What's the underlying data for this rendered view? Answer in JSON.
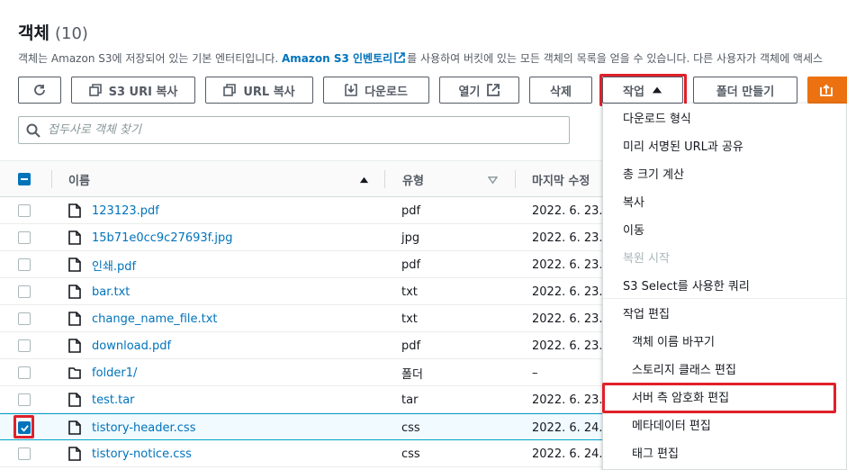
{
  "header": {
    "title": "객체",
    "count": "(10)",
    "description_before": "객체는 Amazon S3에 저장되어 있는 기본 엔터티입니다. ",
    "description_link": "Amazon S3 인벤토리",
    "description_after": "를 사용하여 버킷에 있는 모든 객체의 목록을 얻을 수 있습니다. 다른 사용자가 객체에 액세스"
  },
  "toolbar": {
    "refresh_icon": "refresh-icon",
    "copy_s3_uri": "S3 URI 복사",
    "copy_url": "URL 복사",
    "download": "다운로드",
    "open": "열기",
    "delete": "삭제",
    "actions": "작업",
    "create_folder": "폴더 만들기",
    "upload_icon": "upload-icon"
  },
  "search": {
    "placeholder": "접두사로 객체 찾기"
  },
  "table": {
    "columns": {
      "name": "이름",
      "type": "유형",
      "modified": "마지막 수정"
    },
    "rows": [
      {
        "name": "123123.pdf",
        "type": "pdf",
        "modified": "2022. 6. 23.",
        "icon": "file-icon",
        "checked": false
      },
      {
        "name": "15b71e0cc9c27693f.jpg",
        "type": "jpg",
        "modified": "2022. 6. 23.",
        "icon": "file-icon",
        "checked": false
      },
      {
        "name": "인쇄.pdf",
        "type": "pdf",
        "modified": "2022. 6. 23.",
        "icon": "file-icon",
        "checked": false
      },
      {
        "name": "bar.txt",
        "type": "txt",
        "modified": "2022. 6. 23.",
        "icon": "file-icon",
        "checked": false
      },
      {
        "name": "change_name_file.txt",
        "type": "txt",
        "modified": "2022. 6. 23.",
        "icon": "file-icon",
        "checked": false
      },
      {
        "name": "download.pdf",
        "type": "pdf",
        "modified": "2022. 6. 23.",
        "icon": "file-icon",
        "checked": false
      },
      {
        "name": "folder1/",
        "type": "폴더",
        "modified": "–",
        "icon": "folder-icon",
        "checked": false
      },
      {
        "name": "test.tar",
        "type": "tar",
        "modified": "2022. 6. 23.",
        "icon": "file-icon",
        "checked": false
      },
      {
        "name": "tistory-header.css",
        "type": "css",
        "modified": "2022. 6. 24.",
        "icon": "file-icon",
        "checked": true
      },
      {
        "name": "tistory-notice.css",
        "type": "css",
        "modified": "2022. 6. 24.",
        "icon": "file-icon",
        "checked": false
      }
    ]
  },
  "actions_menu": {
    "items": [
      {
        "label": "다운로드 형식",
        "enabled": true
      },
      {
        "label": "미리 서명된 URL과 공유",
        "enabled": true
      },
      {
        "label": "총 크기 계산",
        "enabled": true
      },
      {
        "label": "복사",
        "enabled": true
      },
      {
        "label": "이동",
        "enabled": true
      },
      {
        "label": "복원 시작",
        "enabled": false
      },
      {
        "label": "S3 Select를 사용한 쿼리",
        "enabled": true
      }
    ],
    "edit_group_label": "작업 편집",
    "edit_items": [
      {
        "label": "객체 이름 바꾸기"
      },
      {
        "label": "스토리지 클래스 편집"
      },
      {
        "label": "서버 측 암호화 편집"
      },
      {
        "label": "메타데이터 편집"
      },
      {
        "label": "태그 편집"
      }
    ]
  },
  "colors": {
    "link": "#0073bb",
    "highlight": "#e0202a",
    "primary_orange": "#ec7211"
  }
}
